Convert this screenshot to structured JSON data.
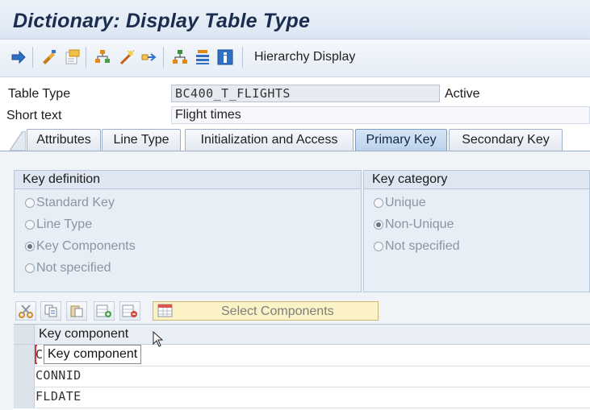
{
  "window": {
    "title": "Dictionary: Display Table Type"
  },
  "toolbar": {
    "icons": [
      "back-arrow-icon",
      "display-change-icon",
      "activate-icon",
      "check-icon",
      "where-used-icon",
      "navigate-icon",
      "hierarchy-icon",
      "layout-icon",
      "info-icon"
    ],
    "hierarchy_label": "Hierarchy Display"
  },
  "header": {
    "table_type_label": "Table Type",
    "table_type_value": "BC400_T_FLIGHTS",
    "status": "Active",
    "short_text_label": "Short text",
    "short_text_value": "Flight times"
  },
  "tabs": [
    {
      "label": "Attributes",
      "active": false
    },
    {
      "label": "Line Type",
      "active": false
    },
    {
      "label": "Initialization and Access",
      "active": false
    },
    {
      "label": "Primary Key",
      "active": true
    },
    {
      "label": "Secondary Key",
      "active": false
    }
  ],
  "key_definition": {
    "title": "Key definition",
    "options": [
      {
        "label": "Standard Key",
        "selected": false
      },
      {
        "label": "Line Type",
        "selected": false
      },
      {
        "label": "Key Components",
        "selected": true
      },
      {
        "label": "Not specified",
        "selected": false
      }
    ]
  },
  "key_category": {
    "title": "Key category",
    "options": [
      {
        "label": "Unique",
        "selected": false
      },
      {
        "label": "Non-Unique",
        "selected": true
      },
      {
        "label": "Not specified",
        "selected": false
      }
    ]
  },
  "table_toolbar": {
    "icons": [
      "cut-icon",
      "copy-icon",
      "paste-icon",
      "insert-row-icon",
      "delete-row-icon",
      "select-components-icon"
    ],
    "select_components_label": "Select Components"
  },
  "key_table": {
    "column_header": "Key component",
    "rows": [
      "CARRID",
      "CONNID",
      "FLDATE"
    ],
    "first_row_visible_fragment": "C"
  },
  "tooltip": {
    "text": "Key component"
  },
  "colors": {
    "title": "#1b2d4f",
    "active_tab": "#bcd2ec",
    "panel_bg": "#f0f4f9",
    "select_button_bg": "#fbf3c6",
    "cursor_red": "#d43a3a"
  }
}
